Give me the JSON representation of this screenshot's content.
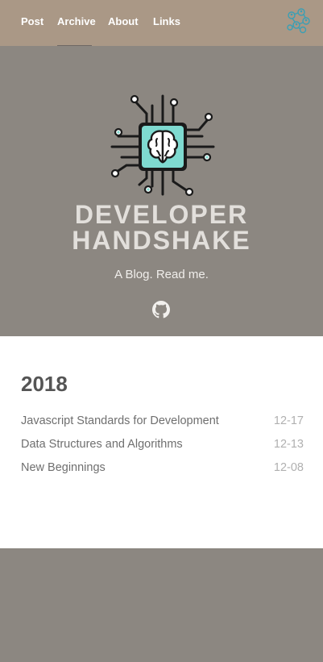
{
  "nav": {
    "items": [
      {
        "label": "Post"
      },
      {
        "label": "Archive"
      },
      {
        "label": "About"
      },
      {
        "label": "Links"
      }
    ],
    "active_item": "Archive",
    "right_icon": "network-people-icon"
  },
  "hero": {
    "logo_icon": "brain-chip-icon",
    "title_line1": "DEVELOPER",
    "title_line2": "HANDSHAKE",
    "subtitle": "A Blog. Read me.",
    "github_icon": "github-icon"
  },
  "archive": {
    "year": "2018",
    "posts": [
      {
        "title": "Javascript Standards for Development",
        "date": "12-17"
      },
      {
        "title": "Data Structures and Algorithms",
        "date": "12-13"
      },
      {
        "title": "New Beginnings",
        "date": "12-08"
      }
    ]
  },
  "colors": {
    "navbar": "#aa9886",
    "hero": "#8c8781",
    "chip": "#7fdad0",
    "accent_icon": "#3a9fb5"
  }
}
